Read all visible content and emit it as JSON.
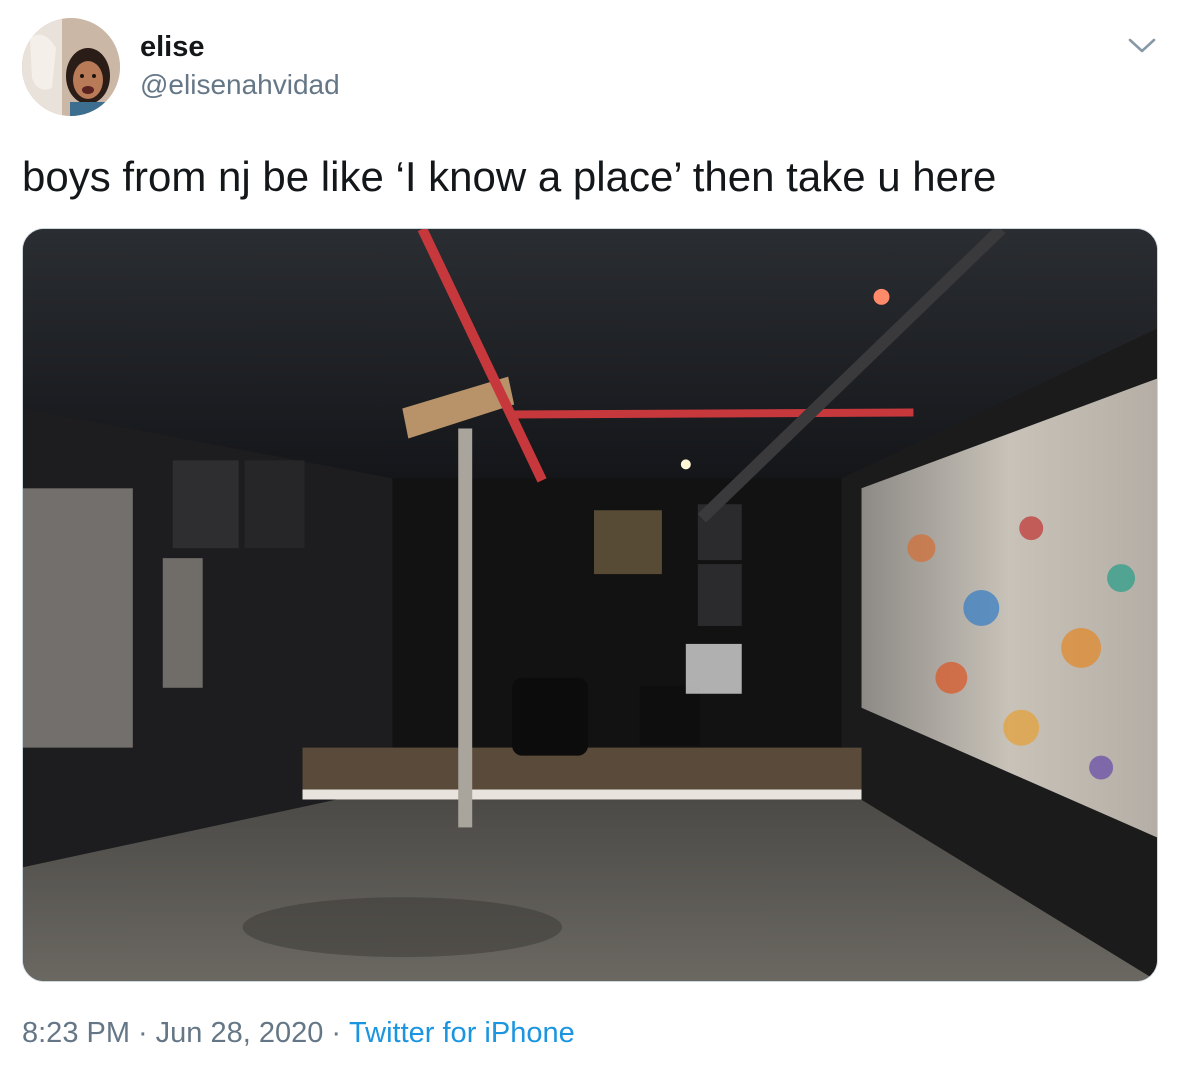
{
  "user": {
    "display_name": "elise",
    "handle": "@elisenahvidad"
  },
  "tweet": {
    "text": "boys from nj be like ‘I know a place’ then take u here"
  },
  "meta": {
    "time": "8:23 PM",
    "separator": "·",
    "date": "Jun 28, 2020",
    "source": "Twitter for iPhone"
  },
  "icons": {
    "menu": "chevron-down-icon"
  },
  "colors": {
    "text": "#14171a",
    "secondary": "#657786",
    "link": "#1b95e0",
    "border": "#ccd6dd"
  }
}
